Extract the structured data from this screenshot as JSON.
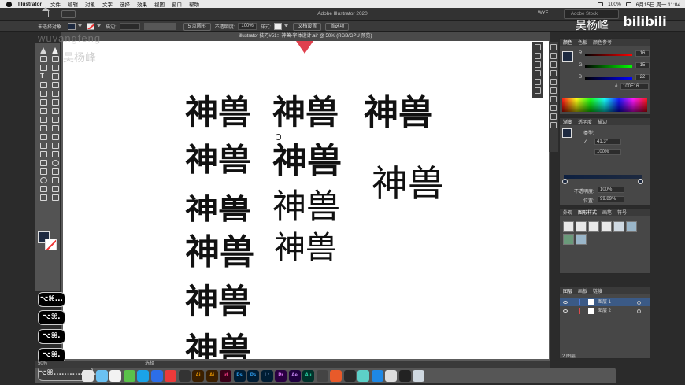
{
  "menubar": {
    "app_name": "Illustrator",
    "items": [
      "文件",
      "编辑",
      "对象",
      "文字",
      "选择",
      "效果",
      "视图",
      "窗口",
      "帮助"
    ],
    "status_text": "100%",
    "date_text": "6月15日 周一 11:04"
  },
  "app_header": {
    "title": "Adobe Illustrator 2020",
    "workspace": "WYF",
    "search_placeholder": "Adobe Stock"
  },
  "control_bar": {
    "selection_label": "未选择对象",
    "stroke_label": "描边:",
    "brush_label": "5 点圆形",
    "opacity_label": "不透明度:",
    "opacity_value": "100%",
    "style_label": "样式:",
    "doc_setup_button": "文档设置",
    "prefs_button": "首选项"
  },
  "document": {
    "tab_title": "illustrator 技巧#51：神兽-字体设计.ai* @ 50% (RGB/GPU 预览)",
    "zoom": "50%",
    "status_mode": "选择"
  },
  "artwork": {
    "text": "神兽"
  },
  "shortcuts": [
    "⌥⌘...",
    "⌥⌘.",
    "⌥⌘.",
    "⌥⌘.",
    "⌥⌘................"
  ],
  "color_panel": {
    "tabs": [
      "颜色",
      "色板",
      "颜色参考"
    ],
    "channels": [
      {
        "name": "R",
        "value": "16"
      },
      {
        "name": "G",
        "value": "15"
      },
      {
        "name": "B",
        "value": "22"
      }
    ],
    "hex": "100F16",
    "fill_color": "#100F16"
  },
  "gradient_panel": {
    "tabs": [
      "渐变",
      "透明度",
      "描边"
    ],
    "type_label": "类型:",
    "angle": "41.3°",
    "ratio": "100%",
    "opacity_label": "不透明度:",
    "opacity_value": "100%",
    "location_label": "位置:",
    "location_value": "99.89%"
  },
  "styles_panel": {
    "tabs": [
      "外观",
      "图形样式",
      "画笔",
      "符号"
    ]
  },
  "layers_panel": {
    "tabs": [
      "图层",
      "画板",
      "链接"
    ],
    "layers": [
      {
        "name": "图层 1",
        "color": "#4f7bd8",
        "selected": true
      },
      {
        "name": "图层 2",
        "color": "#e04a4a",
        "selected": false
      }
    ],
    "footer": "2 图层"
  },
  "watermarks": {
    "pinyin": "wuyangfeng",
    "author": "吴杨峰",
    "channel_author": "吴杨峰",
    "brand": "bilibili"
  },
  "dock": {
    "apps": [
      "Ai",
      "Ai",
      "Id",
      "Ps",
      "Ps",
      "Lr",
      "Pr",
      "Ae",
      "Au"
    ]
  }
}
